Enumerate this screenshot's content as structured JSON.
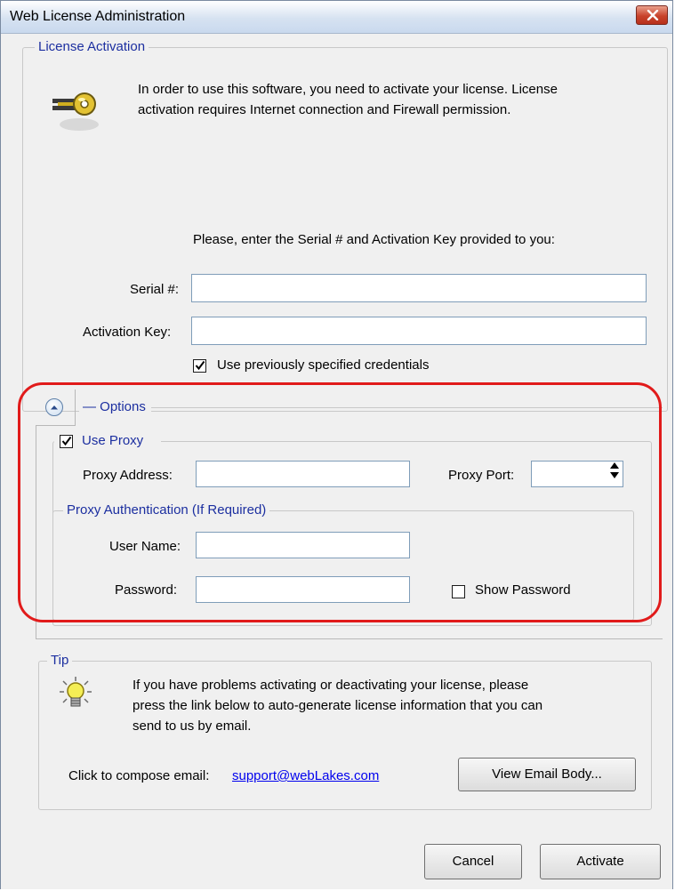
{
  "window": {
    "title": "Web License Administration"
  },
  "activation": {
    "legend": "License Activation",
    "description_line1": "In order to use this software, you need to activate your license. License",
    "description_line2": "activation requires Internet connection and Firewall permission.",
    "prompt": "Please, enter the Serial # and Activation Key provided to you:",
    "serial_label": "Serial #:",
    "serial_value": "",
    "key_label": "Activation Key:",
    "key_value": "",
    "use_previous_label": "Use previously specified credentials",
    "use_previous_checked": true
  },
  "options": {
    "legend": "— Options",
    "use_proxy_label": "Use Proxy",
    "use_proxy_checked": true,
    "proxy_address_label": "Proxy Address:",
    "proxy_address_value": "",
    "proxy_port_label": "Proxy Port:",
    "proxy_port_value": "",
    "auth_legend": "Proxy Authentication (If Required)",
    "username_label": "User Name:",
    "username_value": "",
    "password_label": "Password:",
    "password_value": "",
    "show_password_label": "Show Password",
    "show_password_checked": false
  },
  "tip": {
    "legend": "Tip",
    "text_line1": "If you have problems activating or deactivating your license, please",
    "text_line2": "press the link below to auto-generate license information that you can",
    "text_line3": "send to us by email.",
    "compose_label": "Click to compose email:",
    "email_link": "support@webLakes.com",
    "view_email_button": "View Email Body..."
  },
  "buttons": {
    "cancel": "Cancel",
    "activate": "Activate"
  },
  "colors": {
    "highlight": "#e11b1b",
    "legend_text": "#1c2fa0",
    "link": "#0000ee"
  },
  "icons": {
    "key": "key-icon",
    "bulb": "lightbulb-icon",
    "collapse": "chevron-up-icon"
  }
}
